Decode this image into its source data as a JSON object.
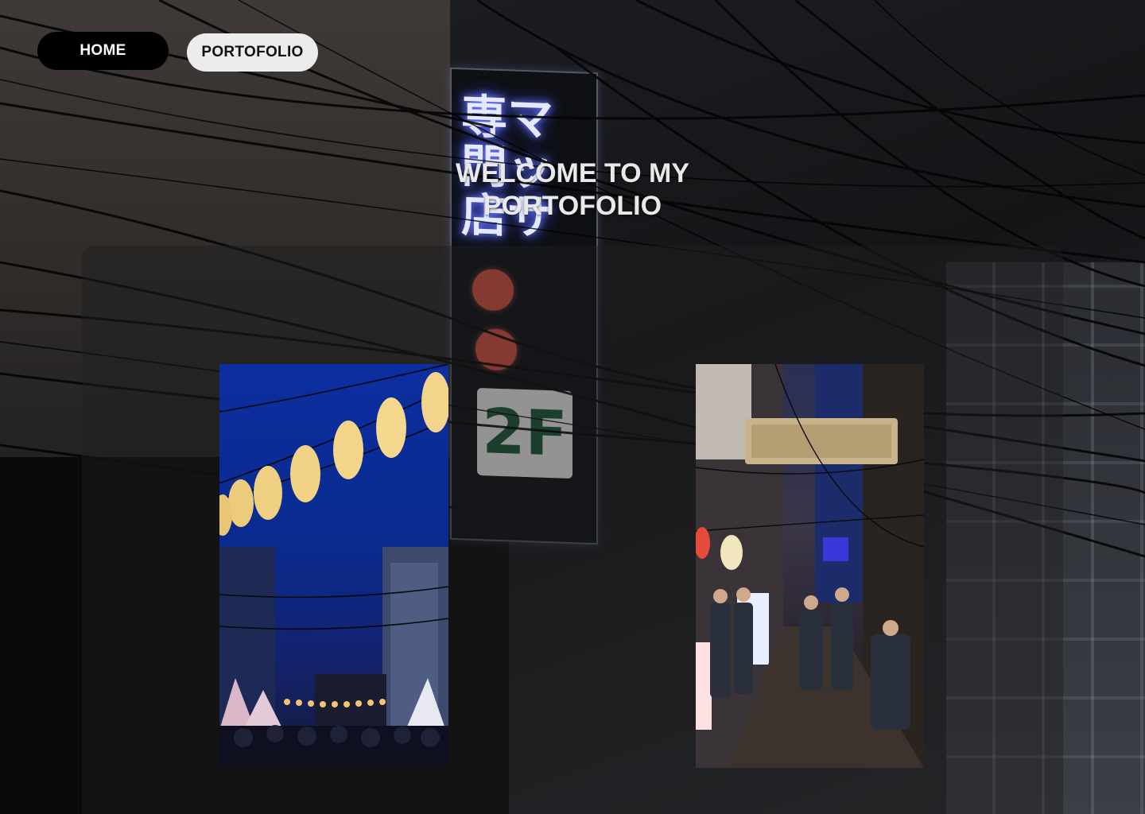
{
  "nav": {
    "home_label": "HOME",
    "portfolio_label": "PORTOFOLIO"
  },
  "hero": {
    "title": "WELCOME TO MY PORTOFOLIO"
  },
  "background_sign": {
    "glyphs": "専マ門ッ店サ",
    "floor_label": "2F"
  },
  "gallery": {
    "photos": [
      {
        "subject": "paper lanterns over a night festival street"
      },
      {
        "subject": "neon-lit alley with shop signs and people"
      }
    ]
  },
  "colors": {
    "nav_home_bg": "#000000",
    "nav_home_text": "#ffffff",
    "nav_portfolio_bg": "#ececec",
    "nav_portfolio_text": "#111111",
    "title_text": "#e9e9e9",
    "neon_blue": "#6d7dff"
  }
}
